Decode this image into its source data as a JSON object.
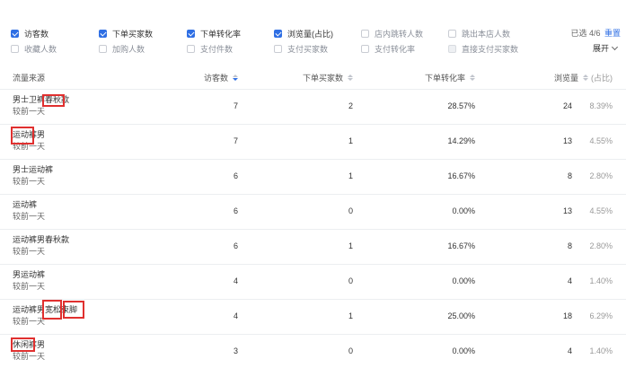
{
  "filters": {
    "row1": [
      {
        "label": "访客数",
        "checked": true
      },
      {
        "label": "下单买家数",
        "checked": true
      },
      {
        "label": "下单转化率",
        "checked": true
      },
      {
        "label": "浏览量(占比)",
        "checked": true
      },
      {
        "label": "店内跳转人数",
        "checked": false
      },
      {
        "label": "跳出本店人数",
        "checked": false
      }
    ],
    "row2": [
      {
        "label": "收藏人数",
        "checked": false
      },
      {
        "label": "加购人数",
        "checked": false
      },
      {
        "label": "支付件数",
        "checked": false
      },
      {
        "label": "支付买家数",
        "checked": false
      },
      {
        "label": "支付转化率",
        "checked": false
      },
      {
        "label": "直接支付买家数",
        "checked": false,
        "disabled": true
      }
    ],
    "selected_text": "已选 4/6",
    "reset_label": "重置",
    "expand_label": "展开"
  },
  "table": {
    "headers": {
      "source": "流量来源",
      "visitors": "访客数",
      "buyers": "下单买家数",
      "rate": "下单转化率",
      "views": "浏览量",
      "views_sub": "(占比)"
    },
    "rows": [
      {
        "source": "男士卫裤春秋款",
        "compare": "较前一天",
        "visitors": "7",
        "buyers": "2",
        "rate": "28.57%",
        "views": "24",
        "pct": "8.39%"
      },
      {
        "source": "运动裤男",
        "compare": "较前一天",
        "visitors": "7",
        "buyers": "1",
        "rate": "14.29%",
        "views": "13",
        "pct": "4.55%"
      },
      {
        "source": "男士运动裤",
        "compare": "较前一天",
        "visitors": "6",
        "buyers": "1",
        "rate": "16.67%",
        "views": "8",
        "pct": "2.80%"
      },
      {
        "source": "运动裤",
        "compare": "较前一天",
        "visitors": "6",
        "buyers": "0",
        "rate": "0.00%",
        "views": "13",
        "pct": "4.55%"
      },
      {
        "source": "运动裤男春秋款",
        "compare": "较前一天",
        "visitors": "6",
        "buyers": "1",
        "rate": "16.67%",
        "views": "8",
        "pct": "2.80%"
      },
      {
        "source": "男运动裤",
        "compare": "较前一天",
        "visitors": "4",
        "buyers": "0",
        "rate": "0.00%",
        "views": "4",
        "pct": "1.40%"
      },
      {
        "source": "运动裤男宽松束脚",
        "compare": "较前一天",
        "visitors": "4",
        "buyers": "1",
        "rate": "25.00%",
        "views": "18",
        "pct": "6.29%"
      },
      {
        "source": "休闲裤男",
        "compare": "较前一天",
        "visitors": "3",
        "buyers": "0",
        "rate": "0.00%",
        "views": "4",
        "pct": "1.40%"
      }
    ]
  },
  "colors": {
    "accent": "#2f6fe4",
    "highlight": "#e0302f"
  }
}
